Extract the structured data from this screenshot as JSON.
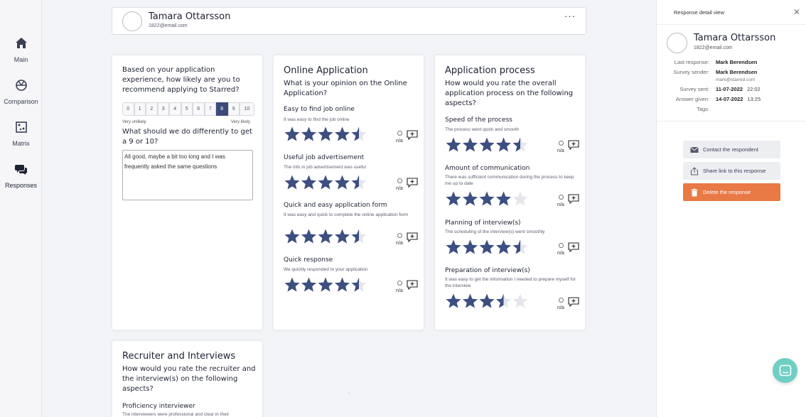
{
  "nav": {
    "main": "Main",
    "comparison": "Comparison",
    "matrix": "Matrix",
    "responses": "Responses"
  },
  "header": {
    "name": "Tamara Ottarsson",
    "email": "1822@email.com",
    "more": "···"
  },
  "card1": {
    "question": "Based on your application experience, how likely are you to recommend applying to Starred?",
    "scale": [
      "0",
      "1",
      "2",
      "3",
      "4",
      "5",
      "6",
      "7",
      "8",
      "9",
      "10"
    ],
    "selected": "8",
    "low_label": "Very unlikely",
    "high_label": "Very likely",
    "followup": "What should we do differently to get a 9 or 10?",
    "answer": "All good, maybe a bit too long and I was frequently asked the same questions"
  },
  "card2": {
    "title": "Online Application",
    "question": "What is your opinion on the Online Application?",
    "items": [
      {
        "title": "Easy to find job online",
        "desc": "It was easy to find the job online",
        "rating": 4.5
      },
      {
        "title": "Useful job advertisement",
        "desc": "The info in job advertisement was useful",
        "rating": 4.5
      },
      {
        "title": "Quick and easy application form",
        "desc": "It was easy and quick to complete the online application form",
        "rating": 4.5
      },
      {
        "title": "Quick response",
        "desc": "We quickly responded to your application",
        "rating": 4.5
      }
    ]
  },
  "card3": {
    "title": "Application process",
    "question": "How would you rate the overall application process on the following aspects?",
    "items": [
      {
        "title": "Speed of the process",
        "desc": "The process went quick and smooth",
        "rating": 4.5
      },
      {
        "title": "Amount of communication",
        "desc": "There was sufficient communication during the process to keep me up to date",
        "rating": 4
      },
      {
        "title": "Planning of interview(s)",
        "desc": "The scheduling of the interview(s) went smoothly",
        "rating": 4.5
      },
      {
        "title": "Preparation of interview(s)",
        "desc": "It was easy to get the information I needed to prepare myself for the interview",
        "rating": 3.5
      }
    ]
  },
  "card4": {
    "title": "Recruiter and Interviews",
    "question": "How would you rate the recruiter and the interview(s) on the following aspects?",
    "items": [
      {
        "title": "Proficiency interviewer",
        "desc": "The interviewers were professional and clear in their"
      }
    ]
  },
  "na_label": "n/a",
  "panel": {
    "title": "Response detail view",
    "name": "Tamara Ottarsson",
    "email": "1822@email.com",
    "last_response_label": "Last response:",
    "last_response": "Mark Berendsen",
    "survey_sender_label": "Survey sender:",
    "survey_sender": "Mark Berendsen",
    "survey_sender_email": "mark@starred.com",
    "survey_sent_label": "Survey sent:",
    "survey_sent_date": "11-07-2022",
    "survey_sent_time": "22:02",
    "answer_given_label": "Answer given:",
    "answer_given_date": "14-07-2022",
    "answer_given_time": "13:25",
    "tags_label": "Tags:",
    "contact_btn": "Contact the respondent",
    "share_btn": "Share link to this response",
    "delete_btn": "Delete the response"
  },
  "colors": {
    "star": "#3d4f80",
    "star_empty": "#e4e6ec",
    "selected_scale": "#3c4b7a",
    "delete": "#e97a45",
    "chat": "#6ecfc3"
  }
}
